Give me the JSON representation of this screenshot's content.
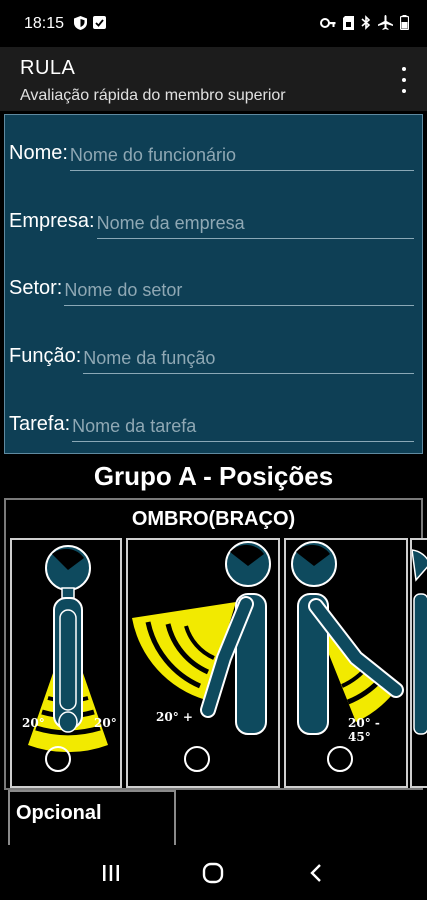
{
  "status_bar": {
    "time": "18:15",
    "left_icons": [
      "shield-icon",
      "screenshot-icon"
    ],
    "right_icons": [
      "key-icon",
      "sim-icon",
      "bluetooth-icon",
      "airplane-icon",
      "battery-icon"
    ]
  },
  "app_bar": {
    "title": "RULA",
    "subtitle": "Avaliação rápida do membro superior",
    "overflow_icon": "more-vert-icon"
  },
  "form": {
    "fields": [
      {
        "label": "Nome:",
        "placeholder": "Nome do funcionário",
        "value": ""
      },
      {
        "label": "Empresa:",
        "placeholder": "Nome da empresa",
        "value": ""
      },
      {
        "label": "Setor:",
        "placeholder": "Nome do setor",
        "value": ""
      },
      {
        "label": "Função:",
        "placeholder": "Nome da função",
        "value": ""
      },
      {
        "label": "Tarefa:",
        "placeholder": "Nome da tarefa",
        "value": ""
      }
    ]
  },
  "group_a": {
    "title": "Grupo A - Posições",
    "shoulder": {
      "title": "OMBRO(BRAÇO)",
      "options": [
        {
          "labels": [
            "20°",
            "20°"
          ],
          "selected": false
        },
        {
          "labels": [
            "20° +"
          ],
          "selected": false
        },
        {
          "labels": [
            "20° - 45°"
          ],
          "selected": false
        }
      ]
    }
  },
  "optional": {
    "title": "Opcional"
  },
  "colors": {
    "form_bg": "#0e3f55",
    "figure": "#0e4a5e",
    "highlight": "#f2ea00"
  },
  "nav": {
    "icons": [
      "recents-icon",
      "home-icon",
      "back-icon"
    ]
  }
}
